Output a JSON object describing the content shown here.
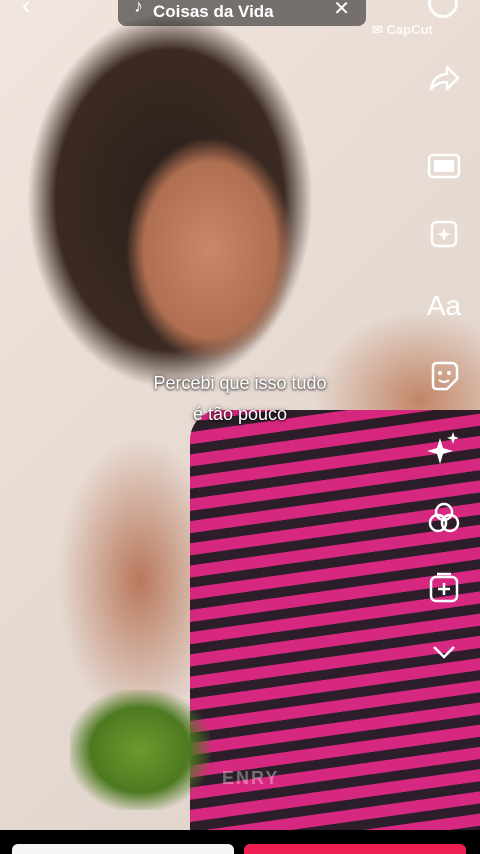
{
  "music": {
    "title": "Coisas da Vida"
  },
  "watermark": "CapCut",
  "caption": {
    "line1": "Percebi que isso tudo",
    "line2": "é tão pouco"
  },
  "sidebar": {
    "items": [
      {
        "name": "share-icon"
      },
      {
        "name": "template-icon"
      },
      {
        "name": "effects-icon"
      },
      {
        "name": "text-icon",
        "label": "Aa"
      },
      {
        "name": "sticker-icon"
      },
      {
        "name": "sparkle-icon"
      },
      {
        "name": "filters-icon"
      },
      {
        "name": "add-clip-icon"
      },
      {
        "name": "chevron-down-icon"
      }
    ]
  },
  "creator_mark": "ENRY",
  "colors": {
    "accent": "#ee1d52",
    "shirt_pink": "#d61f7c",
    "shirt_dark": "#231521"
  }
}
